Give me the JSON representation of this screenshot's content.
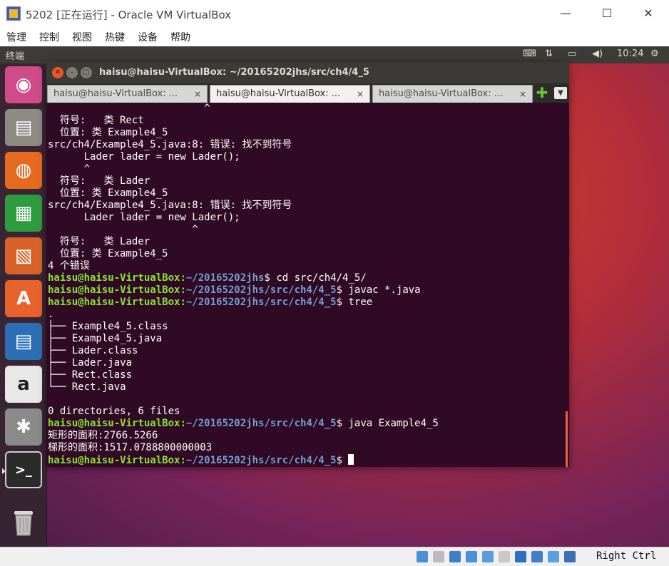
{
  "vbox": {
    "title": "5202 [正在运行] - Oracle VM VirtualBox",
    "window_controls": {
      "minimize": "—",
      "maximize": "☐",
      "close": "✕"
    },
    "menu": [
      "管理",
      "控制",
      "视图",
      "热键",
      "设备",
      "帮助"
    ],
    "host_key": "Right Ctrl"
  },
  "top_panel": {
    "app_name": "终端",
    "indicators": {
      "keyboard": "⌨",
      "network": "⇅",
      "battery": "▭",
      "volume": "◀)",
      "settings": "⚙"
    },
    "clock": "10:24"
  },
  "launcher": [
    {
      "name": "ubuntu-dash",
      "glyph": "◉",
      "color": "#cf4b8a"
    },
    {
      "name": "files",
      "glyph": "▤",
      "color": "#8e8a84"
    },
    {
      "name": "firefox",
      "glyph": "◍",
      "color": "#e66a1f"
    },
    {
      "name": "libreoffice-calc",
      "glyph": "▦",
      "color": "#2e9b3e"
    },
    {
      "name": "libreoffice-impress",
      "glyph": "▧",
      "color": "#d8622a"
    },
    {
      "name": "ubuntu-software",
      "glyph": "A",
      "color": "#e9622b"
    },
    {
      "name": "libreoffice-writer",
      "glyph": "▤",
      "color": "#2d6fb5"
    },
    {
      "name": "amazon",
      "glyph": "a",
      "color": "#e8e8e8"
    },
    {
      "name": "system-settings",
      "glyph": "✱",
      "color": "#8a8a8a"
    },
    {
      "name": "terminal",
      "glyph": ">_",
      "color": "#2b2b2b"
    }
  ],
  "terminal": {
    "title": "haisu@haisu-VirtualBox: ~/20165202jhs/src/ch4/4_5",
    "tabs": [
      {
        "label": "haisu@haisu-VirtualBox: ...",
        "active": false
      },
      {
        "label": "haisu@haisu-VirtualBox: ...",
        "active": true
      },
      {
        "label": "haisu@haisu-VirtualBox: ...",
        "active": false
      }
    ],
    "tab_close": "×",
    "tab_add": "✚",
    "tab_menu": "▼",
    "lines": [
      {
        "text": "                          ^"
      },
      {
        "text": "  符号:   类 Rect"
      },
      {
        "text": "  位置: 类 Example4_5"
      },
      {
        "text": "src/ch4/Example4_5.java:8: 错误: 找不到符号"
      },
      {
        "text": "      Lader lader = new Lader();"
      },
      {
        "text": "      ^"
      },
      {
        "text": "  符号:   类 Lader"
      },
      {
        "text": "  位置: 类 Example4_5"
      },
      {
        "text": "src/ch4/Example4_5.java:8: 错误: 找不到符号"
      },
      {
        "text": "      Lader lader = new Lader();"
      },
      {
        "text": "                        ^"
      },
      {
        "text": "  符号:   类 Lader"
      },
      {
        "text": "  位置: 类 Example4_5"
      },
      {
        "text": "4 个错误"
      },
      {
        "user": "haisu@haisu-VirtualBox",
        "path": "~/20165202jhs",
        "cmd": " cd src/ch4/4_5/"
      },
      {
        "user": "haisu@haisu-VirtualBox",
        "path": "~/20165202jhs/src/ch4/4_5",
        "cmd": " javac *.java"
      },
      {
        "user": "haisu@haisu-VirtualBox",
        "path": "~/20165202jhs/src/ch4/4_5",
        "cmd": " tree"
      },
      {
        "text": "."
      },
      {
        "text": "├── Example4_5.class"
      },
      {
        "text": "├── Example4_5.java"
      },
      {
        "text": "├── Lader.class"
      },
      {
        "text": "├── Lader.java"
      },
      {
        "text": "├── Rect.class"
      },
      {
        "text": "└── Rect.java"
      },
      {
        "text": ""
      },
      {
        "text": "0 directories, 6 files"
      },
      {
        "user": "haisu@haisu-VirtualBox",
        "path": "~/20165202jhs/src/ch4/4_5",
        "cmd": " java Example4_5"
      },
      {
        "text": "矩形的面积:2766.5266"
      },
      {
        "text": "梯形的面积:1517.0788800000003"
      },
      {
        "user": "haisu@haisu-VirtualBox",
        "path": "~/20165202jhs/src/ch4/4_5",
        "cmd": " ",
        "cursor": true
      }
    ]
  },
  "status_icons": [
    "hdd",
    "optical",
    "network",
    "usb",
    "shared-folder",
    "display",
    "video-capture",
    "mouse-integration",
    "cpu",
    "keyboard-capture"
  ]
}
